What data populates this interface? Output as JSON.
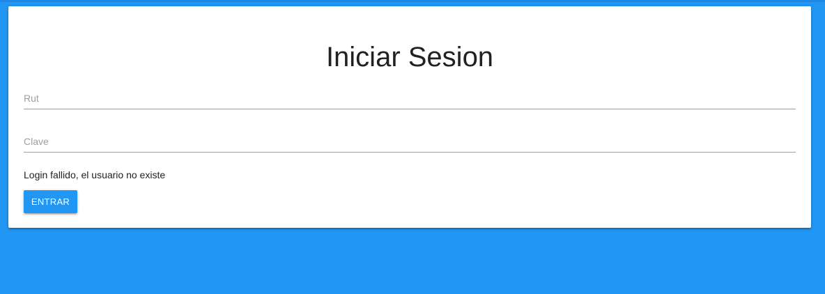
{
  "login": {
    "title": "Iniciar Sesion",
    "rut": {
      "placeholder": "Rut",
      "value": ""
    },
    "clave": {
      "placeholder": "Clave",
      "value": ""
    },
    "error_message": "Login fallido, el usuario no existe",
    "submit_label": "ENTRAR"
  },
  "colors": {
    "background": "#2196f3",
    "card": "#ffffff",
    "button": "#2196f3",
    "button_text": "#ffffff"
  }
}
